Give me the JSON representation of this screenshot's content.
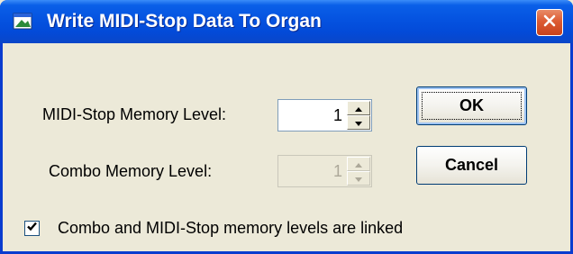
{
  "window": {
    "title": "Write MIDI-Stop Data To Organ"
  },
  "fields": {
    "midi_stop_label": "MIDI-Stop Memory Level:",
    "midi_stop_value": "1",
    "combo_label": "Combo Memory Level:",
    "combo_value": "1"
  },
  "buttons": {
    "ok_label": "OK",
    "cancel_label": "Cancel"
  },
  "options": {
    "linked_label": "Combo and MIDI-Stop memory levels are linked",
    "linked_checked": true
  },
  "icons": {
    "app": "app-window-icon",
    "close": "close-icon",
    "spin_up": "triangle-up-icon",
    "spin_down": "triangle-down-icon",
    "check": "checkmark-icon"
  },
  "colors": {
    "titlebar": "#0553e0",
    "close": "#dc5b33",
    "dialog_bg": "#ece9d8"
  }
}
